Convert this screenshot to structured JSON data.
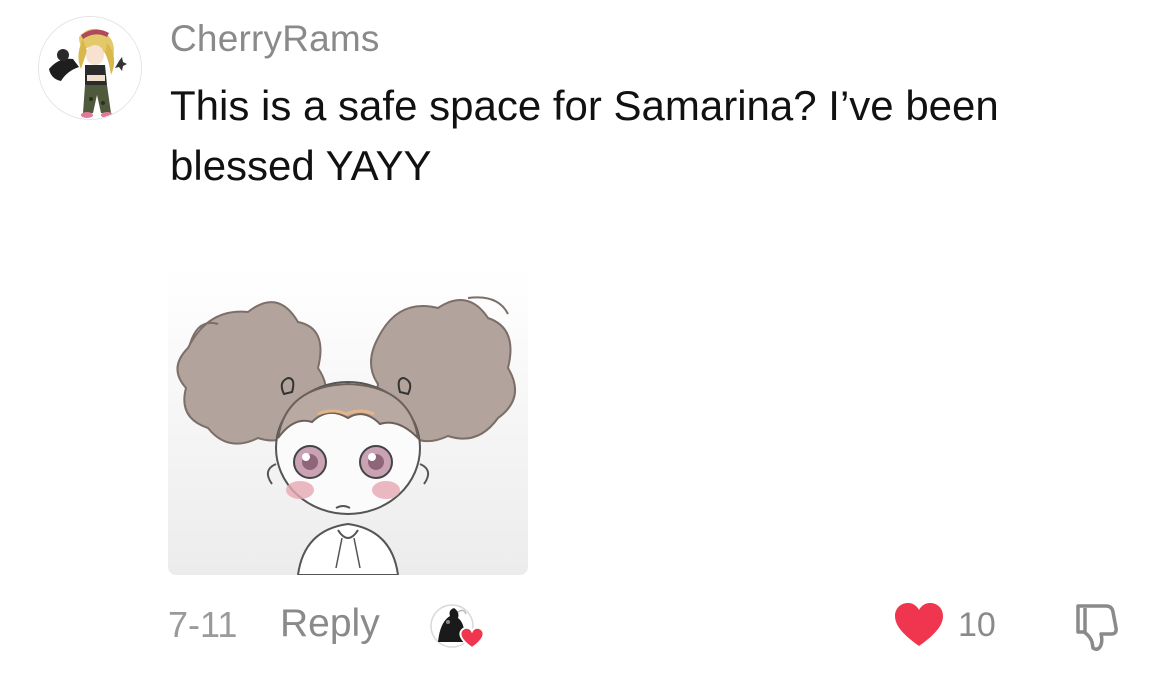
{
  "comment": {
    "username": "CherryRams",
    "text": "This is a safe space for Samarina? I’ve been blessed YAYY",
    "date": "7-11",
    "reply_label": "Reply",
    "like_count": "10",
    "liked": true
  },
  "colors": {
    "like_red": "#f0364f",
    "secondary_text": "#8a8a8a",
    "primary_text": "#111111"
  },
  "icons": {
    "avatar": "anime-character-avatar",
    "attachment": "sketch-girl-pigtails-image",
    "creator_badge": "creator-avatar-with-heart-icon",
    "like": "heart-icon",
    "dislike": "thumbs-down-icon"
  }
}
